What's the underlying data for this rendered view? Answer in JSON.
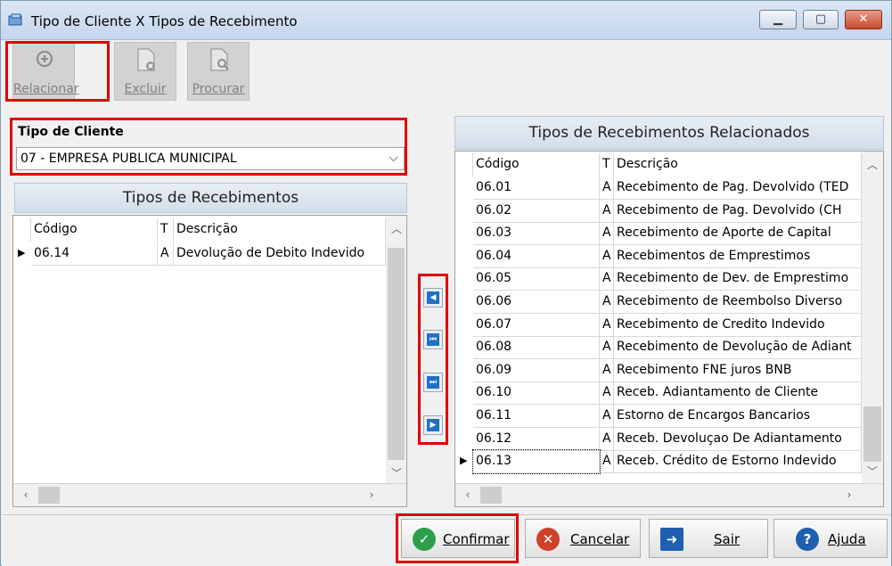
{
  "window": {
    "title": "Tipo de Cliente X Tipos de Recebimento"
  },
  "toolbar": {
    "relacionar_label": "Relacionar",
    "excluir_label": "Excluir",
    "procurar_label": "Procurar"
  },
  "tipo_cliente": {
    "label": "Tipo de Cliente",
    "value": "07 - EMPRESA PUBLICA MUNICIPAL"
  },
  "left_panel": {
    "title": "Tipos de Recebimentos",
    "columns": [
      "Código",
      "T",
      "Descrição"
    ],
    "rows": [
      {
        "codigo": "06.14",
        "t": "A",
        "descricao": "Devolução de Debito Indevido"
      }
    ]
  },
  "right_panel": {
    "title": "Tipos de Recebimentos Relacionados",
    "columns": [
      "Código",
      "T",
      "Descrição"
    ],
    "rows": [
      {
        "codigo": "06.01",
        "t": "A",
        "descricao": "Recebimento de Pag. Devolvido (TED"
      },
      {
        "codigo": "06.02",
        "t": "A",
        "descricao": "Recebimento de Pag. Devolvido (CH"
      },
      {
        "codigo": "06.03",
        "t": "A",
        "descricao": "Recebimento de Aporte de Capital"
      },
      {
        "codigo": "06.04",
        "t": "A",
        "descricao": "Recebimentos de Emprestimos"
      },
      {
        "codigo": "06.05",
        "t": "A",
        "descricao": "Recebimento de Dev. de Emprestimo"
      },
      {
        "codigo": "06.06",
        "t": "A",
        "descricao": "Recebimento de Reembolso Diverso"
      },
      {
        "codigo": "06.07",
        "t": "A",
        "descricao": "Recebimento de Credito Indevido"
      },
      {
        "codigo": "06.08",
        "t": "A",
        "descricao": "Recebimento de Devolução de Adiant"
      },
      {
        "codigo": "06.09",
        "t": "A",
        "descricao": "Recebimento FNE juros BNB"
      },
      {
        "codigo": "06.10",
        "t": "A",
        "descricao": "Receb. Adiantamento de Cliente"
      },
      {
        "codigo": "06.11",
        "t": "A",
        "descricao": "Estorno de Encargos Bancarios"
      },
      {
        "codigo": "06.12",
        "t": "A",
        "descricao": "Receb. Devoluçao De Adiantamento"
      },
      {
        "codigo": "06.13",
        "t": "A",
        "descricao": "Receb. Crédito de Estorno Indevido"
      }
    ]
  },
  "footer": {
    "confirmar_label": "Confirmar",
    "cancelar_label": "Cancelar",
    "sair_label": "Sair",
    "ajuda_label": "Ajuda"
  },
  "colors": {
    "highlight": "#e00000",
    "confirm_green": "#2e9e4a",
    "cancel_red": "#d0402a",
    "help_blue": "#1e5fb0"
  }
}
